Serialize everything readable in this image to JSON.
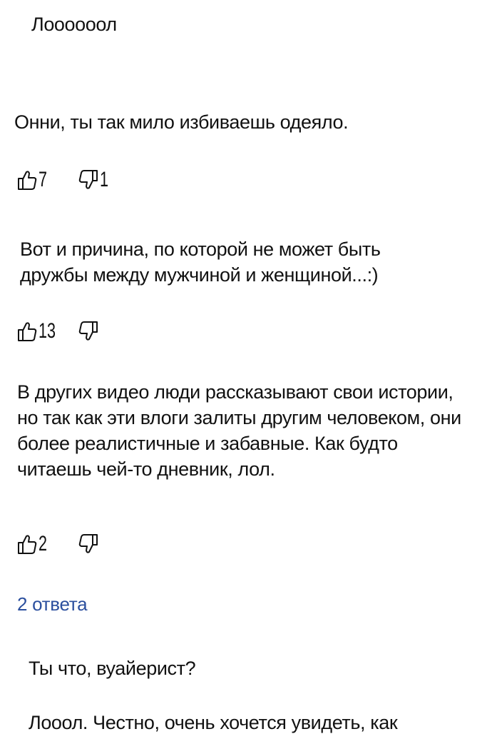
{
  "colors": {
    "text": "#111111",
    "link": "#2b4f9e",
    "background": "#ffffff"
  },
  "comments": [
    {
      "text": "Лоооооол"
    },
    {
      "text": "Онни, ты так мило избиваешь одеяло.",
      "likes": "7",
      "dislikes": "1"
    },
    {
      "text": "Вот и причина, по которой не может быть дружбы между мужчиной и женщиной...:)",
      "likes": "13",
      "dislikes": ""
    },
    {
      "text": "В других видео люди рассказывают свои истории, но так как эти влоги залиты другим человеком, они более реалистичные и забавные. Как будто читаешь чей-то дневник, лол.",
      "likes": "2",
      "dislikes": "",
      "replies_label": "2 ответа"
    },
    {
      "text": "Ты что, вуайерист?"
    },
    {
      "text": "Лооол. Честно, очень хочется увидеть, как"
    }
  ],
  "icons": {
    "like": "thumbs-up-icon",
    "dislike": "thumbs-down-icon"
  }
}
